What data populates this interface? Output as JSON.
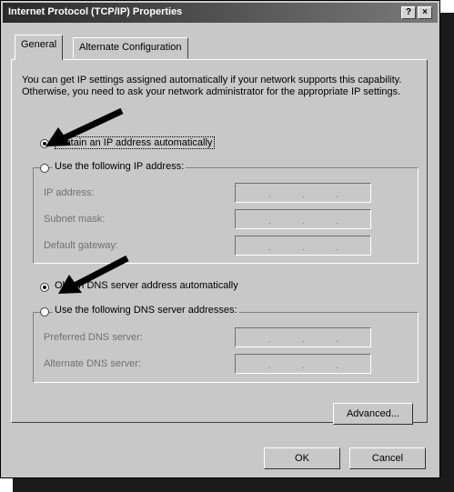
{
  "window": {
    "title": "Internet Protocol (TCP/IP) Properties",
    "help_glyph": "?",
    "close_glyph": "×"
  },
  "tabs": [
    {
      "label": "General"
    },
    {
      "label": "Alternate Configuration"
    }
  ],
  "description": "You can get IP settings assigned automatically if your network supports this capability. Otherwise, you need to ask your network administrator for the appropriate IP settings.",
  "ip": {
    "auto_label": "Obtain an IP address automatically",
    "manual_label": "Use the following IP address:",
    "fields": [
      {
        "label": "IP address:"
      },
      {
        "label": "Subnet mask:"
      },
      {
        "label": "Default gateway:"
      }
    ]
  },
  "dns": {
    "auto_label": "Obtain DNS server address automatically",
    "manual_label": "Use the following DNS server addresses:",
    "fields": [
      {
        "label": "Preferred DNS server:"
      },
      {
        "label": "Alternate DNS server:"
      }
    ]
  },
  "buttons": {
    "advanced": "Advanced...",
    "ok": "OK",
    "cancel": "Cancel"
  },
  "dot": "."
}
